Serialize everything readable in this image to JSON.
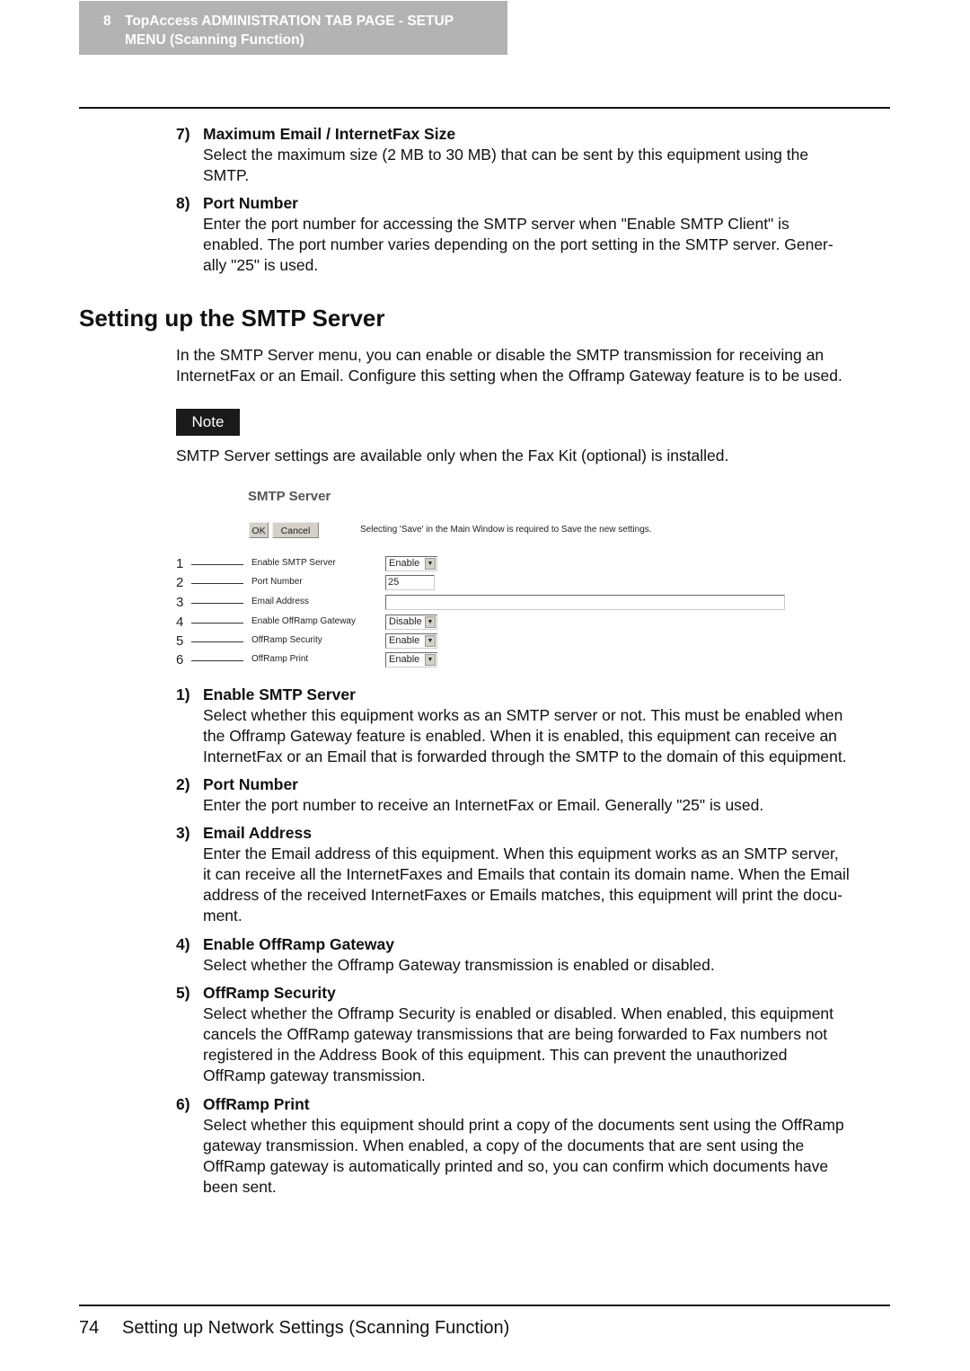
{
  "header": {
    "chapter_number": "8",
    "chapter_title_line1": "TopAccess ADMINISTRATION TAB PAGE - SETUP",
    "chapter_title_line2": "MENU (Scanning Function)"
  },
  "smtp_client_items": [
    {
      "number": "7)",
      "title": "Maximum Email / InternetFax Size",
      "lines": [
        "Select the maximum size (2 MB to 30 MB) that can be sent by this equipment using the",
        "SMTP."
      ]
    },
    {
      "number": "8)",
      "title": "Port Number",
      "lines": [
        "Enter the port number for accessing the SMTP server when \"Enable SMTP Client\" is",
        "enabled. The port number varies depending on the port setting in the SMTP server. Gener-",
        "ally \"25\" is used."
      ]
    }
  ],
  "section": {
    "title": "Setting up the SMTP Server",
    "intro_lines": [
      "In the SMTP Server menu, you can enable or disable the SMTP transmission for receiving an",
      "InternetFax or an Email. Configure this setting when the Offramp Gateway feature is to be used."
    ],
    "note_label": "Note",
    "note_text": "SMTP Server settings are available only when the Fax Kit (optional) is installed."
  },
  "figure": {
    "title": "SMTP Server",
    "ok_label": "OK",
    "cancel_label": "Cancel",
    "message": "Selecting 'Save' in the Main Window is required to Save the new settings.",
    "rows": [
      {
        "callout": "1",
        "label": "Enable SMTP Server",
        "type": "select",
        "value": "Enable"
      },
      {
        "callout": "2",
        "label": "Port Number",
        "type": "text",
        "value": "25"
      },
      {
        "callout": "3",
        "label": "Email Address",
        "type": "text",
        "value": ""
      },
      {
        "callout": "4",
        "label": "Enable OffRamp Gateway",
        "type": "select",
        "value": "Disable"
      },
      {
        "callout": "5",
        "label": "OffRamp Security",
        "type": "select",
        "value": "Enable"
      },
      {
        "callout": "6",
        "label": "OffRamp Print",
        "type": "select",
        "value": "Enable"
      }
    ],
    "dropdown_arrow_icon": "▼"
  },
  "smtp_server_items": [
    {
      "number": "1)",
      "title": "Enable SMTP Server",
      "lines": [
        "Select whether this equipment works as an SMTP server or not. This must be enabled when",
        "the Offramp Gateway feature is enabled. When it is enabled, this equipment can receive an",
        "InternetFax or an Email that is forwarded through the SMTP to the domain of this equipment."
      ]
    },
    {
      "number": "2)",
      "title": "Port Number",
      "lines": [
        "Enter the port number to receive an InternetFax or Email. Generally \"25\" is used."
      ]
    },
    {
      "number": "3)",
      "title": "Email Address",
      "lines": [
        "Enter the Email address of this equipment. When this equipment works as an SMTP server,",
        "it can receive all the InternetFaxes and Emails that contain its domain name. When the Email",
        "address of the received InternetFaxes or Emails matches, this equipment will print the docu-",
        "ment."
      ]
    },
    {
      "number": "4)",
      "title": "Enable OffRamp Gateway",
      "lines": [
        "Select whether the Offramp Gateway transmission is enabled or disabled."
      ]
    },
    {
      "number": "5)",
      "title": "OffRamp Security",
      "lines": [
        "Select whether the Offramp Security is enabled or disabled. When enabled, this equipment",
        "cancels the OffRamp gateway transmissions that are being forwarded to Fax numbers not",
        "registered in the Address Book of this equipment. This can prevent the unauthorized",
        "OffRamp gateway transmission."
      ]
    },
    {
      "number": "6)",
      "title": "OffRamp Print",
      "lines": [
        "Select whether this equipment should print a copy of the documents sent using the OffRamp",
        "gateway transmission. When enabled, a copy of the documents that are sent using the",
        "OffRamp gateway is automatically printed and so, you can confirm which documents have",
        "been sent."
      ]
    }
  ],
  "footer": {
    "page_number": "74",
    "section_title": "Setting up Network Settings (Scanning Function)"
  }
}
